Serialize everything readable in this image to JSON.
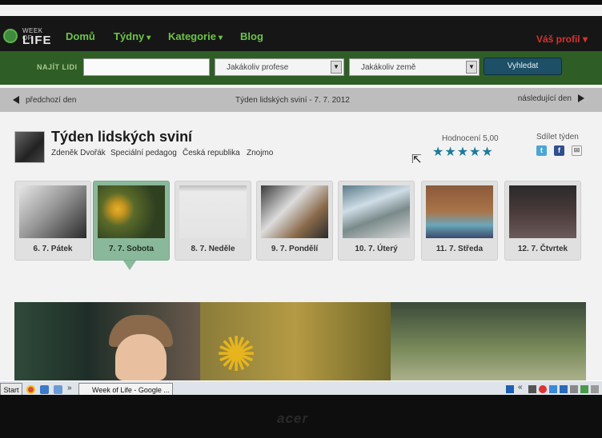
{
  "nav": {
    "logo_top": "WEEK OF",
    "logo_bottom": "LIFE",
    "items": [
      {
        "label": "Domů"
      },
      {
        "label": "Týdny",
        "dropdown": true
      },
      {
        "label": "Kategorie",
        "dropdown": true
      },
      {
        "label": "Blog"
      }
    ],
    "profile": "Váš profil"
  },
  "search": {
    "label": "NAJÍT LIDI",
    "input_value": "",
    "profession": "Jakákoliv profese",
    "country": "Jakákoliv země",
    "button": "Vyhledat"
  },
  "daynav": {
    "prev": "předchozí den",
    "title": "Týden lidských sviní - 7. 7. 2012",
    "next": "následující den"
  },
  "week": {
    "title": "Týden lidských sviní",
    "author": "Zdeněk Dvořák",
    "profession": "Speciální pedagog",
    "country": "Česká republika",
    "city": "Znojmo",
    "rating_label": "Hodnocení 5,00",
    "rating_value": 5,
    "rating_max": 5,
    "stars": "★★★★★",
    "share_label": "Sdílet týden"
  },
  "days": [
    {
      "label": "6. 7. Pátek"
    },
    {
      "label": "7. 7. Sobota",
      "active": true
    },
    {
      "label": "8. 7. Neděle"
    },
    {
      "label": "9. 7. Pondělí"
    },
    {
      "label": "10. 7. Úterý"
    },
    {
      "label": "11. 7. Středa"
    },
    {
      "label": "12. 7. Čtvrtek"
    }
  ],
  "taskbar": {
    "start": "Start",
    "window": "Week of Life - Google ..."
  },
  "monitor": {
    "brand": "acer"
  },
  "colors": {
    "accent_green": "#6cc449",
    "profile_red": "#d6332e",
    "star_blue": "#1d7a9a",
    "active_card": "#8ab89a"
  }
}
